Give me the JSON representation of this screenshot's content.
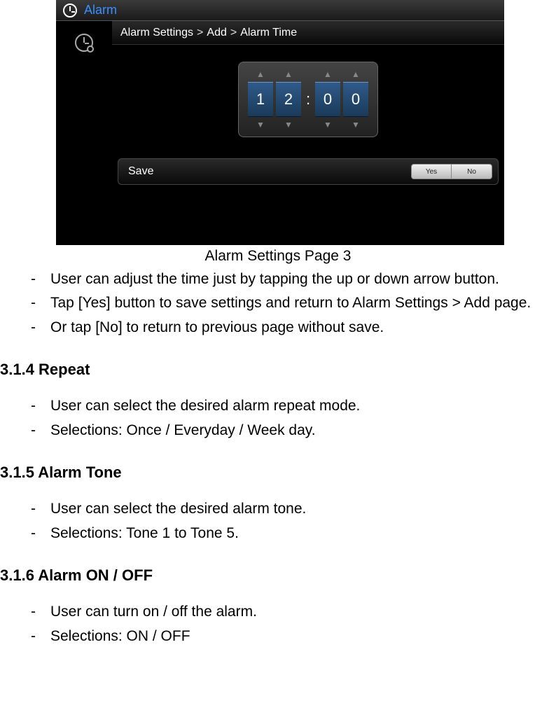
{
  "screenshot": {
    "header_title": "Alarm",
    "breadcrumb": {
      "part1": "Alarm Settings",
      "part2": "Add",
      "part3": "Alarm  Time"
    },
    "time_picker": {
      "digits": [
        "1",
        "2",
        "0",
        "0"
      ]
    },
    "save_row": {
      "label": "Save",
      "yes": "Yes",
      "no": "No"
    }
  },
  "caption": "Alarm Settings Page 3",
  "sec1_bullets": [
    "User can adjust the time just by tapping the up or down arrow button.",
    "Tap [Yes] button to save settings and return to Alarm Settings > Add page.",
    "Or tap [No] to return to previous page without save."
  ],
  "sec_repeat": {
    "heading": "3.1.4 Repeat",
    "bullets": [
      "User can select the desired alarm repeat mode.",
      "Selections: Once / Everyday / Week day."
    ]
  },
  "sec_tone": {
    "heading": "3.1.5 Alarm Tone",
    "bullets": [
      "User can select the desired alarm tone.",
      "Selections: Tone 1 to Tone 5."
    ]
  },
  "sec_onoff": {
    "heading": "3.1.6 Alarm ON / OFF",
    "bullets": [
      "User can turn on / off the alarm.",
      "Selections: ON / OFF"
    ]
  }
}
